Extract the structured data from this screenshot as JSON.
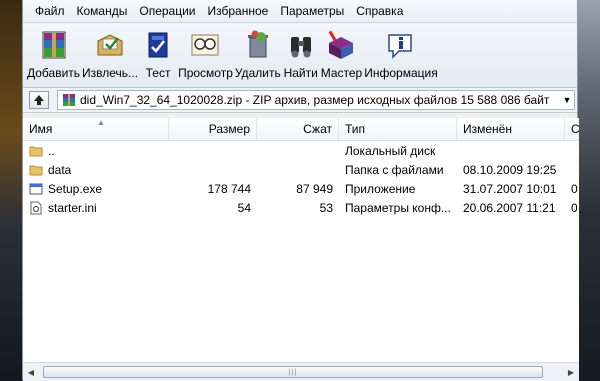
{
  "menu": [
    "Файл",
    "Команды",
    "Операции",
    "Избранное",
    "Параметры",
    "Справка"
  ],
  "toolbar": [
    {
      "label": "Добавить",
      "icon": "add-archive-icon"
    },
    {
      "label": "Извлечь...",
      "icon": "extract-icon"
    },
    {
      "label": "Тест",
      "icon": "test-icon"
    },
    {
      "label": "Просмотр",
      "icon": "view-icon"
    },
    {
      "label": "Удалить",
      "icon": "delete-icon"
    },
    {
      "label": "Найти",
      "icon": "find-icon"
    },
    {
      "label": "Мастер",
      "icon": "wizard-icon"
    },
    {
      "label": "Информация",
      "icon": "info-icon"
    }
  ],
  "address": {
    "text": "did_Win7_32_64_1020028.zip - ZIP архив, размер исходных файлов 15 588 086 байт"
  },
  "columns": [
    "Имя",
    "Размер",
    "Сжат",
    "Тип",
    "Изменён",
    "C"
  ],
  "rows": [
    {
      "name": "..",
      "size": "",
      "packed": "",
      "type": "Локальный диск",
      "modified": "",
      "icon": "parent-folder-icon"
    },
    {
      "name": "data",
      "size": "",
      "packed": "",
      "type": "Папка с файлами",
      "modified": "08.10.2009 19:25",
      "icon": "folder-icon"
    },
    {
      "name": "Setup.exe",
      "size": "178 744",
      "packed": "87 949",
      "type": "Приложение",
      "modified": "31.07.2007 10:01",
      "icon": "exe-icon"
    },
    {
      "name": "starter.ini",
      "size": "54",
      "packed": "53",
      "type": "Параметры конф...",
      "modified": "20.06.2007 11:21",
      "icon": "ini-icon"
    }
  ],
  "crc_col": [
    "",
    "",
    "0",
    "0"
  ]
}
